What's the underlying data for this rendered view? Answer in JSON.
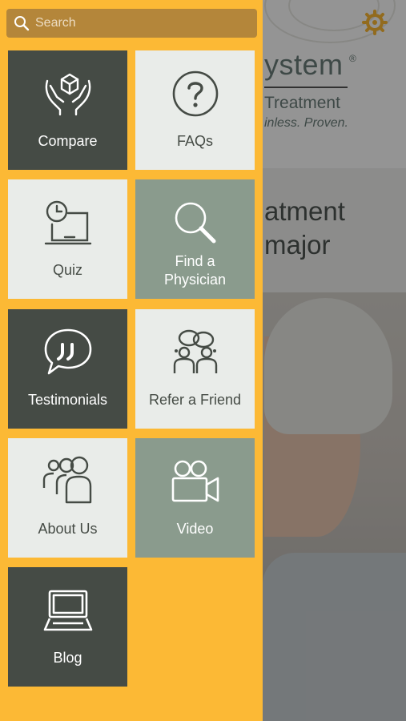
{
  "search": {
    "placeholder": "Search",
    "icon": "search-icon"
  },
  "background": {
    "logo_main": "ystem",
    "logo_reg": "®",
    "logo_sub": "Treatment",
    "logo_tagline": "inless. Proven.",
    "headline_line1": "atment",
    "headline_line2": "major",
    "settings_icon": "gear-icon"
  },
  "tiles": [
    {
      "id": "compare",
      "label": "Compare",
      "icon": "hands-box-icon"
    },
    {
      "id": "faqs",
      "label": "FAQs",
      "icon": "question-icon"
    },
    {
      "id": "quiz",
      "label": "Quiz",
      "icon": "clock-desk-icon"
    },
    {
      "id": "find-physician",
      "label_line1": "Find a",
      "label_line2": "Physician",
      "icon": "magnifier-icon"
    },
    {
      "id": "testimonials",
      "label": "Testimonials",
      "icon": "speech-bubble-icon"
    },
    {
      "id": "refer-friend",
      "label": "Refer a Friend",
      "icon": "friends-talking-icon"
    },
    {
      "id": "about-us",
      "label": "About Us",
      "icon": "group-icon"
    },
    {
      "id": "video",
      "label": "Video",
      "icon": "video-camera-icon"
    },
    {
      "id": "blog",
      "label": "Blog",
      "icon": "laptop-icon"
    }
  ],
  "colors": {
    "drawer": "#fcb935",
    "search_bar": "#b4863a",
    "tile_dark": "#454b45",
    "tile_light": "#e9ece9",
    "tile_sage": "#8a9b8d"
  }
}
